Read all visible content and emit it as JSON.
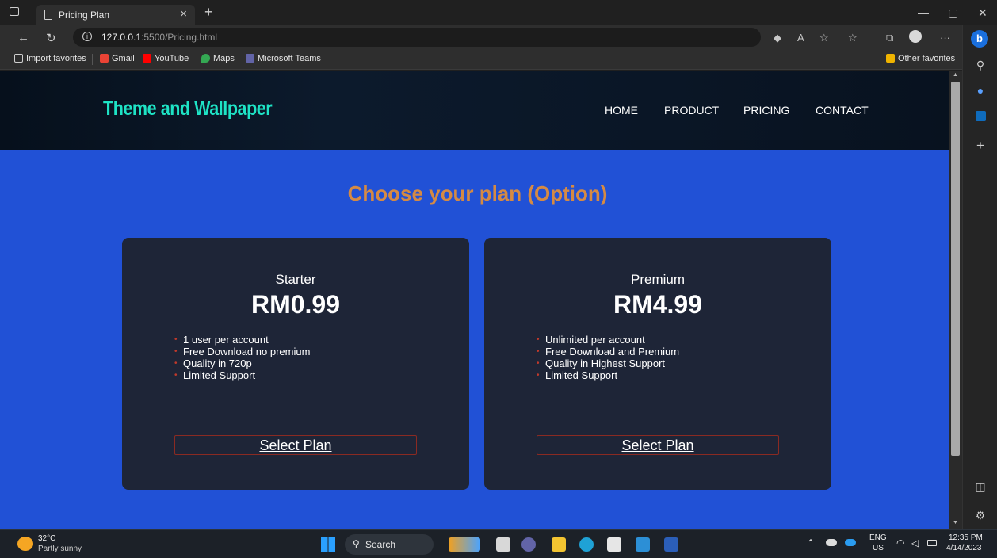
{
  "browser": {
    "tab_title": "Pricing Plan",
    "url_host": "127.0.0.1",
    "url_rest": ":5500/Pricing.html",
    "favorites": [
      "Import favorites",
      "Gmail",
      "YouTube",
      "Maps",
      "Microsoft Teams"
    ],
    "other_favorites": "Other favorites"
  },
  "site": {
    "logo": "Theme and Wallpaper",
    "nav": [
      "HOME",
      "PRODUCT",
      "PRICING",
      "CONTACT"
    ],
    "title": "Choose your plan (Option)",
    "plans": [
      {
        "name": "Starter",
        "price": "RM0.99",
        "features": [
          "1 user per account",
          "Free Download no premium",
          "Quality in 720p",
          "Limited Support"
        ],
        "button": "Select Plan"
      },
      {
        "name": "Premium",
        "price": "RM4.99",
        "features": [
          "Unlimited per account",
          "Free Download and Premium",
          "Quality in Highest Support",
          "Limited Support"
        ],
        "button": "Select Plan"
      }
    ]
  },
  "taskbar": {
    "weather_temp": "32°C",
    "weather_desc": "Partly sunny",
    "search": "Search",
    "lang": "ENG",
    "region": "US",
    "time": "12:35 PM",
    "date": "4/14/2023"
  },
  "colors": {
    "page_bg": "#2151d6",
    "card_bg": "#1e2537",
    "title": "#d58a44",
    "logo": "#1ee3c5"
  }
}
